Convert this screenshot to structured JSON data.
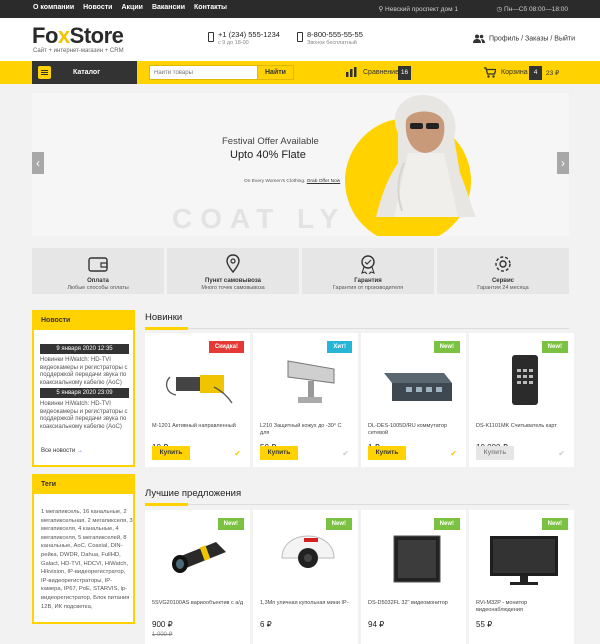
{
  "topnav": {
    "items": [
      "О компании",
      "Новости",
      "Акции",
      "Вакансии",
      "Контакты"
    ],
    "address": "Невский проспект дом 1",
    "hours": "Пн—Сб 08:00—18:00"
  },
  "header": {
    "logo_a": "Fo",
    "logo_x": "x",
    "logo_b": "Store",
    "logo_sub": "Сайт + интернет-магазин + CRM",
    "phone1": "+1 (234) 555-1234",
    "phone1_sub": "с 9 до 18-00",
    "phone2": "8-800-555-55-55",
    "phone2_sub": "Звонок бесплатный",
    "account": "Профиль / Заказы / Выйти"
  },
  "bar": {
    "catalog": "Каталог",
    "search_placeholder": "Найти товары",
    "search_button": "Найти",
    "compare_label": "Сравнение",
    "compare_count": "16",
    "cart_label": "Корзина",
    "cart_count": "4",
    "cart_sum": "23 ₽"
  },
  "hero": {
    "title1": "Festival Offer Available",
    "title2": "Upto 40% Flate",
    "sub": "On Every Women's Clothing.",
    "sub_link": "Grab Offer Now",
    "watermark": "COAT     LY"
  },
  "features": [
    {
      "title": "Оплата",
      "sub": "Любые способы оплаты"
    },
    {
      "title": "Пункт самовывоза",
      "sub": "Много точек самовывоза"
    },
    {
      "title": "Гарантия",
      "sub": "Гарантия от производителя"
    },
    {
      "title": "Сервис",
      "sub": "Гарантия 24 месяца"
    }
  ],
  "news": {
    "title": "Новости",
    "items": [
      {
        "date": "9 января 2020 12:35",
        "text": "Новинки HiWatch: HD-TVI видеокамеры и регистраторы с поддержкой передачи звука по коаксиальному кабелю (AoC)"
      },
      {
        "date": "5 января 2020 23:09",
        "text": "Новинки HiWatch: HD-TVI видеокамеры и регистраторы с поддержкой передачи звука по коаксиальному кабелю (AoC)"
      }
    ],
    "all": "Все новости"
  },
  "tags": {
    "title": "Теги",
    "text": "1 мегапиксель, 16 канальные, 2 мегапиксельная, 2 мегапикселя, 3 мегапикселя, 4 канальные, 4 мегапикселя, 5 мегапикселей, 8 канальные, AoC, Coaxial, DIN-рейка, DWDR, Dahua, FullHD, Galact, HD-TVI, HDCVI, HiWatch, Hikvision, IP-видеорегистратор, IP-видеорегистраторы, IP-камера, IP67, PoE, STARVIS, ip-видеорегистратор, Блок питания 12В, ИК подсветка,"
  },
  "sections": {
    "new": "Новинки",
    "best": "Лучшие предложения"
  },
  "new_products": [
    {
      "badge": "Скидка!",
      "badge_color": "#e53935",
      "name": "M-1201 Активный направленный",
      "price": "10 ₽",
      "buy": "Купить",
      "in_stock": true
    },
    {
      "badge": "Хит!",
      "badge_color": "#26b5d6",
      "name": "L210 Защитный кожух до -30° С для",
      "price": "50 ₽",
      "buy": "Купить",
      "in_stock": false
    },
    {
      "badge": "New!",
      "badge_color": "#7cc242",
      "name": "DL-DES-1005D/RU коммутатор сетевой",
      "price": "1 ₽",
      "buy": "Купить",
      "in_stock": true
    },
    {
      "badge": "New!",
      "badge_color": "#7cc242",
      "name": "DS-K1101MK Считыватель карт",
      "price": "10 000 ₽",
      "buy": "Купить",
      "in_stock": false
    }
  ],
  "best_products": [
    {
      "badge": "New!",
      "badge_color": "#7cc242",
      "name": "5SVG20100AS вариообъектив с а/д",
      "price": "900 ₽",
      "old_price": "1 000 ₽"
    },
    {
      "badge": "New!",
      "badge_color": "#7cc242",
      "name": "1,3Мп уличная купольная мини IP-",
      "price": "6 ₽",
      "old_price": ""
    },
    {
      "badge": "New!",
      "badge_color": "#7cc242",
      "name": "DS-D5032FL 32\" видеомонитор",
      "price": "94 ₽",
      "old_price": ""
    },
    {
      "badge": "New!",
      "badge_color": "#7cc242",
      "name": "RVi-M32P - монитор видеонаблюдения",
      "price": "55 ₽",
      "old_price": ""
    }
  ]
}
